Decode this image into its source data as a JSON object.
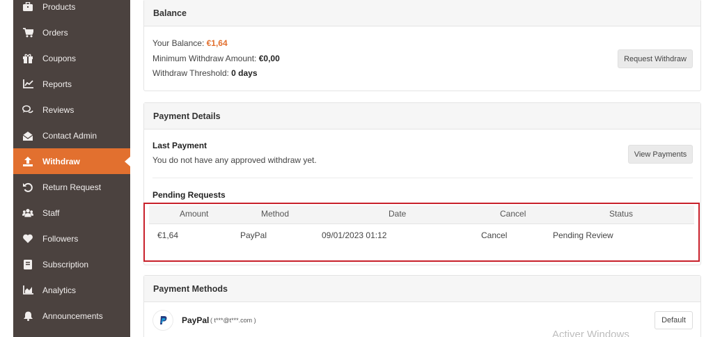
{
  "sidebar": {
    "items": [
      {
        "label": "Products",
        "icon": "briefcase-icon"
      },
      {
        "label": "Orders",
        "icon": "cart-icon"
      },
      {
        "label": "Coupons",
        "icon": "gift-icon"
      },
      {
        "label": "Reports",
        "icon": "chart-line-icon"
      },
      {
        "label": "Reviews",
        "icon": "comments-icon"
      },
      {
        "label": "Contact Admin",
        "icon": "envelope-open-icon"
      },
      {
        "label": "Withdraw",
        "icon": "upload-icon",
        "active": true
      },
      {
        "label": "Return Request",
        "icon": "undo-icon"
      },
      {
        "label": "Staff",
        "icon": "users-icon"
      },
      {
        "label": "Followers",
        "icon": "heart-icon"
      },
      {
        "label": "Subscription",
        "icon": "book-icon"
      },
      {
        "label": "Analytics",
        "icon": "area-chart-icon"
      },
      {
        "label": "Announcements",
        "icon": "bell-icon"
      }
    ]
  },
  "balance": {
    "title": "Balance",
    "your_balance_label": "Your Balance:",
    "your_balance_value": "€1,64",
    "min_withdraw_label": "Minimum Withdraw Amount:",
    "min_withdraw_value": "€0,00",
    "threshold_label": "Withdraw Threshold:",
    "threshold_value": "0 days",
    "request_button": "Request Withdraw"
  },
  "payment_details": {
    "title": "Payment Details",
    "last_payment_heading": "Last Payment",
    "last_payment_text": "You do not have any approved withdraw yet.",
    "view_payments_button": "View Payments",
    "pending_heading": "Pending Requests",
    "table": {
      "headers": [
        "Amount",
        "Method",
        "Date",
        "Cancel",
        "Status"
      ],
      "rows": [
        {
          "amount": "€1,64",
          "method": "PayPal",
          "date": "09/01/2023 01:12",
          "cancel": "Cancel",
          "status": "Pending Review"
        }
      ]
    }
  },
  "payment_methods": {
    "title": "Payment Methods",
    "method_name": "PayPal",
    "method_email": "( t***@t***.com )",
    "default_button": "Default"
  },
  "watermark": "Activer Windows",
  "colors": {
    "accent": "#e2702f",
    "sidebar": "#4b423f",
    "highlight_border": "#c8202a"
  }
}
